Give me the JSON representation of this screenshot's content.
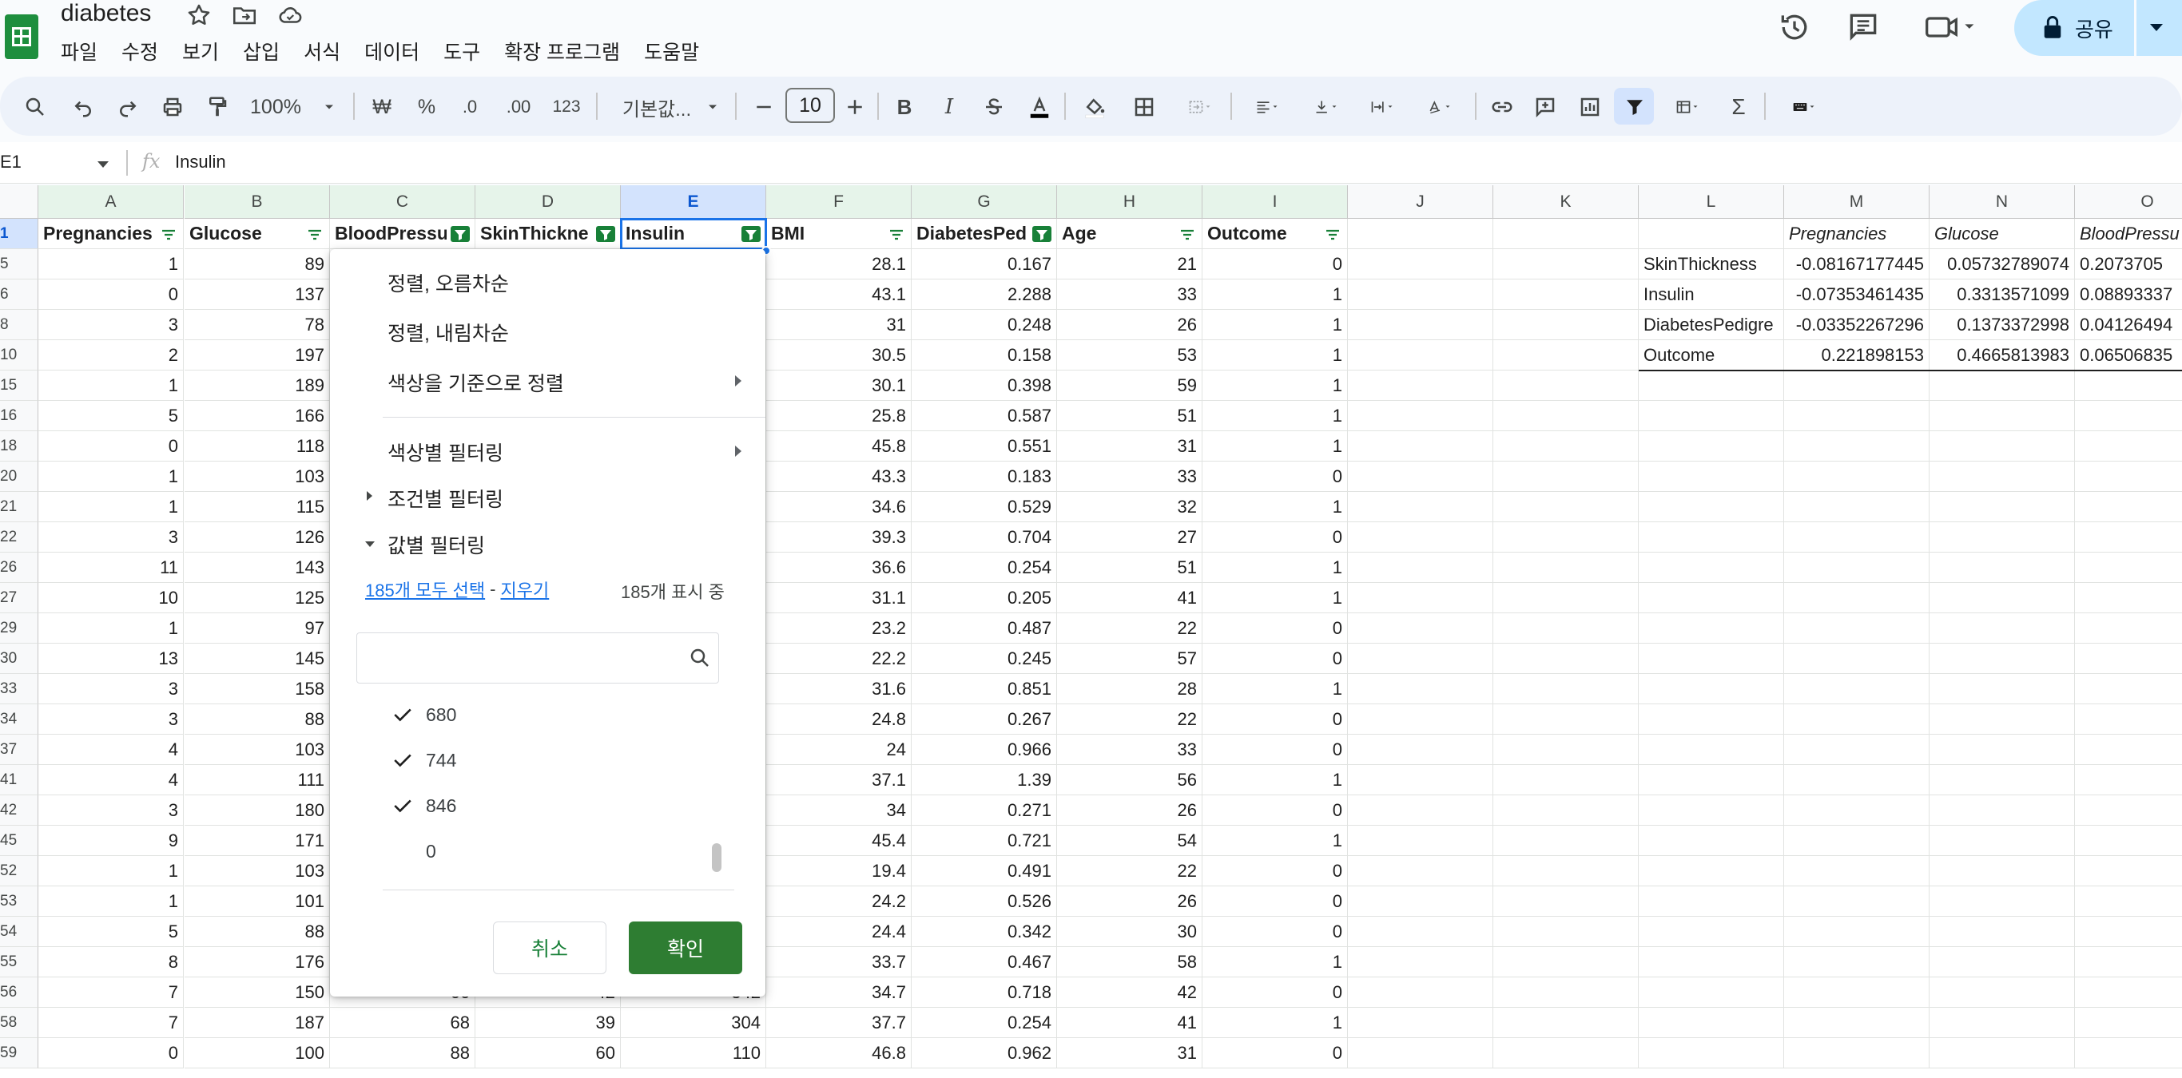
{
  "app": {
    "doc_title": "diabetes",
    "menu": [
      "파일",
      "수정",
      "보기",
      "삽입",
      "서식",
      "데이터",
      "도구",
      "확장 프로그램",
      "도움말"
    ],
    "share_label": "공유"
  },
  "toolbar": {
    "zoom": "100%",
    "currency": "₩",
    "percent": "%",
    "dec_decrease": ".0",
    "dec_increase": ".00",
    "number_format": "123",
    "font_name": "기본값...",
    "font_size": "10",
    "colors": {
      "accent": "#188038",
      "selection": "#1a73e8",
      "toolbar_bg": "#edf2fa"
    }
  },
  "formula_bar": {
    "name_box": "E1",
    "fx": "fx",
    "content": "Insulin"
  },
  "grid": {
    "columns": [
      "A",
      "B",
      "C",
      "D",
      "E",
      "F",
      "G",
      "H",
      "I",
      "J",
      "K",
      "L",
      "M",
      "N",
      "O"
    ],
    "header_row_number": "1",
    "headers": [
      "Pregnancies",
      "Glucose",
      "BloodPressu",
      "SkinThickne",
      "Insulin",
      "BMI",
      "DiabetesPed",
      "Age",
      "Outcome"
    ],
    "rows": [
      {
        "n": "5",
        "A": "1",
        "B": "89",
        "F": "28.1",
        "G": "0.167",
        "H": "21",
        "I": "0"
      },
      {
        "n": "6",
        "A": "0",
        "B": "137",
        "F": "43.1",
        "G": "2.288",
        "H": "33",
        "I": "1"
      },
      {
        "n": "8",
        "A": "3",
        "B": "78",
        "F": "31",
        "G": "0.248",
        "H": "26",
        "I": "1"
      },
      {
        "n": "10",
        "A": "2",
        "B": "197",
        "F": "30.5",
        "G": "0.158",
        "H": "53",
        "I": "1"
      },
      {
        "n": "15",
        "A": "1",
        "B": "189",
        "F": "30.1",
        "G": "0.398",
        "H": "59",
        "I": "1"
      },
      {
        "n": "16",
        "A": "5",
        "B": "166",
        "F": "25.8",
        "G": "0.587",
        "H": "51",
        "I": "1"
      },
      {
        "n": "18",
        "A": "0",
        "B": "118",
        "F": "45.8",
        "G": "0.551",
        "H": "31",
        "I": "1"
      },
      {
        "n": "20",
        "A": "1",
        "B": "103",
        "F": "43.3",
        "G": "0.183",
        "H": "33",
        "I": "0"
      },
      {
        "n": "21",
        "A": "1",
        "B": "115",
        "F": "34.6",
        "G": "0.529",
        "H": "32",
        "I": "1"
      },
      {
        "n": "22",
        "A": "3",
        "B": "126",
        "F": "39.3",
        "G": "0.704",
        "H": "27",
        "I": "0"
      },
      {
        "n": "26",
        "A": "11",
        "B": "143",
        "F": "36.6",
        "G": "0.254",
        "H": "51",
        "I": "1"
      },
      {
        "n": "27",
        "A": "10",
        "B": "125",
        "F": "31.1",
        "G": "0.205",
        "H": "41",
        "I": "1"
      },
      {
        "n": "29",
        "A": "1",
        "B": "97",
        "F": "23.2",
        "G": "0.487",
        "H": "22",
        "I": "0"
      },
      {
        "n": "30",
        "A": "13",
        "B": "145",
        "F": "22.2",
        "G": "0.245",
        "H": "57",
        "I": "0"
      },
      {
        "n": "33",
        "A": "3",
        "B": "158",
        "F": "31.6",
        "G": "0.851",
        "H": "28",
        "I": "1"
      },
      {
        "n": "34",
        "A": "3",
        "B": "88",
        "F": "24.8",
        "G": "0.267",
        "H": "22",
        "I": "0"
      },
      {
        "n": "37",
        "A": "4",
        "B": "103",
        "F": "24",
        "G": "0.966",
        "H": "33",
        "I": "0"
      },
      {
        "n": "41",
        "A": "4",
        "B": "111",
        "F": "37.1",
        "G": "1.39",
        "H": "56",
        "I": "1"
      },
      {
        "n": "42",
        "A": "3",
        "B": "180",
        "F": "34",
        "G": "0.271",
        "H": "26",
        "I": "0"
      },
      {
        "n": "45",
        "A": "9",
        "B": "171",
        "F": "45.4",
        "G": "0.721",
        "H": "54",
        "I": "1"
      },
      {
        "n": "52",
        "A": "1",
        "B": "103",
        "F": "19.4",
        "G": "0.491",
        "H": "22",
        "I": "0"
      },
      {
        "n": "53",
        "A": "1",
        "B": "101",
        "F": "24.2",
        "G": "0.526",
        "H": "26",
        "I": "0"
      },
      {
        "n": "54",
        "A": "5",
        "B": "88",
        "F": "24.4",
        "G": "0.342",
        "H": "30",
        "I": "0"
      },
      {
        "n": "55",
        "A": "8",
        "B": "176",
        "F": "33.7",
        "G": "0.467",
        "H": "58",
        "I": "1"
      },
      {
        "n": "56",
        "A": "7",
        "B": "150",
        "C": "66",
        "D": "42",
        "E": "342",
        "F": "34.7",
        "G": "0.718",
        "H": "42",
        "I": "0"
      },
      {
        "n": "58",
        "A": "7",
        "B": "187",
        "C": "68",
        "D": "39",
        "E": "304",
        "F": "37.7",
        "G": "0.254",
        "H": "41",
        "I": "1"
      },
      {
        "n": "59",
        "A": "0",
        "B": "100",
        "C": "88",
        "D": "60",
        "E": "110",
        "F": "46.8",
        "G": "0.962",
        "H": "31",
        "I": "0"
      }
    ],
    "correlation": {
      "col_headers": [
        "Pregnancies",
        "Glucose",
        "BloodPressu"
      ],
      "rows": [
        {
          "label": "SkinThickness",
          "M": "-0.08167177445",
          "N": "0.05732789074",
          "O": "0.2073705"
        },
        {
          "label": "Insulin",
          "M": "-0.07353461435",
          "N": "0.3313571099",
          "O": "0.08893337"
        },
        {
          "label": "DiabetesPedigre",
          "M": "-0.03352267296",
          "N": "0.1373372998",
          "O": "0.04126494"
        },
        {
          "label": "Outcome",
          "M": "0.221898153",
          "N": "0.4665813983",
          "O": "0.06506835"
        }
      ]
    }
  },
  "filter_menu": {
    "sort_asc": "정렬, 오름차순",
    "sort_desc": "정렬, 내림차순",
    "sort_by_color": "색상을 기준으로 정렬",
    "filter_by_color": "색상별 필터링",
    "filter_by_condition": "조건별 필터링",
    "filter_by_values": "값별 필터링",
    "select_all": "185개 모두 선택",
    "dash": "-",
    "clear": "지우기",
    "showing": "185개 표시 중",
    "search_placeholder": "",
    "values": [
      {
        "label": "680",
        "checked": true
      },
      {
        "label": "744",
        "checked": true
      },
      {
        "label": "846",
        "checked": true
      },
      {
        "label": "0",
        "checked": false
      }
    ],
    "cancel": "취소",
    "ok": "확인"
  }
}
